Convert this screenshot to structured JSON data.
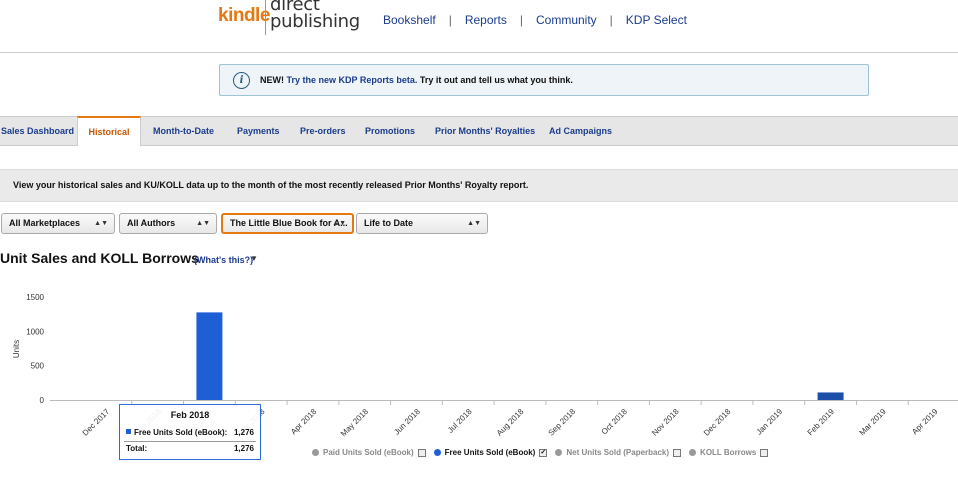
{
  "header": {
    "logo_kindle": "kindle",
    "logo_direct": "direct",
    "logo_publishing": "publishing",
    "nav": [
      "Bookshelf",
      "Reports",
      "Community",
      "KDP Select"
    ],
    "nav_separator": "|"
  },
  "notice": {
    "icon": "info-icon",
    "prefix": "NEW! ",
    "link": "Try the new KDP Reports beta.",
    "suffix": " Try it out and tell us what you think."
  },
  "tabs": [
    {
      "label": "Sales Dashboard"
    },
    {
      "label": "Historical",
      "active": true
    },
    {
      "label": "Month-to-Date"
    },
    {
      "label": "Payments"
    },
    {
      "label": "Pre-orders"
    },
    {
      "label": "Promotions"
    },
    {
      "label": "Prior Months' Royalties"
    },
    {
      "label": "Ad Campaigns"
    }
  ],
  "info_text": "View your historical sales and KU/KOLL data up to the month of the most recently released Prior Months' Royalty report.",
  "filters": [
    {
      "value": "All Marketplaces"
    },
    {
      "value": "All Authors"
    },
    {
      "value": "The Little Blue Book for A...",
      "focused": true
    },
    {
      "value": "Life to Date"
    }
  ],
  "chart_title": "Unit Sales and KOLL Borrows",
  "whats_this": "(What's this?)",
  "chart_data": {
    "type": "bar",
    "ylabel": "Units",
    "ylim": [
      0,
      1500
    ],
    "yticks": [
      "0",
      "500",
      "1000",
      "1500"
    ],
    "categories": [
      "Dec 2017",
      "Jan 2018",
      "Feb 2018",
      "Mar 2018",
      "Apr 2018",
      "May 2018",
      "Jun 2018",
      "Jul 2018",
      "Aug 2018",
      "Sep 2018",
      "Oct 2018",
      "Nov 2018",
      "Dec 2018",
      "Jan 2019",
      "Feb 2019",
      "Mar 2019",
      "Apr 2019"
    ],
    "series": [
      {
        "name": "Free Units Sold (eBook)",
        "color": "#1f5fd6",
        "values": [
          0,
          0,
          1276,
          0,
          0,
          0,
          0,
          0,
          0,
          0,
          0,
          0,
          0,
          0,
          110,
          0,
          0
        ]
      }
    ],
    "bar_colors": {
      "Feb 2018": "#1f5fd6",
      "Feb 2019": "#1c4fa8"
    },
    "grid": false
  },
  "tooltip": {
    "title": "Feb 2018",
    "series_label": "Free Units Sold (eBook):",
    "series_value": "1,276",
    "total_label": "Total:",
    "total_value": "1,276"
  },
  "legend": [
    {
      "label": "Paid Units Sold (eBook)",
      "checked": false
    },
    {
      "label": "Free Units Sold (eBook)",
      "checked": true
    },
    {
      "label": "Net Units Sold (Paperback)",
      "checked": false
    },
    {
      "label": "KOLL Borrows",
      "checked": false
    }
  ]
}
